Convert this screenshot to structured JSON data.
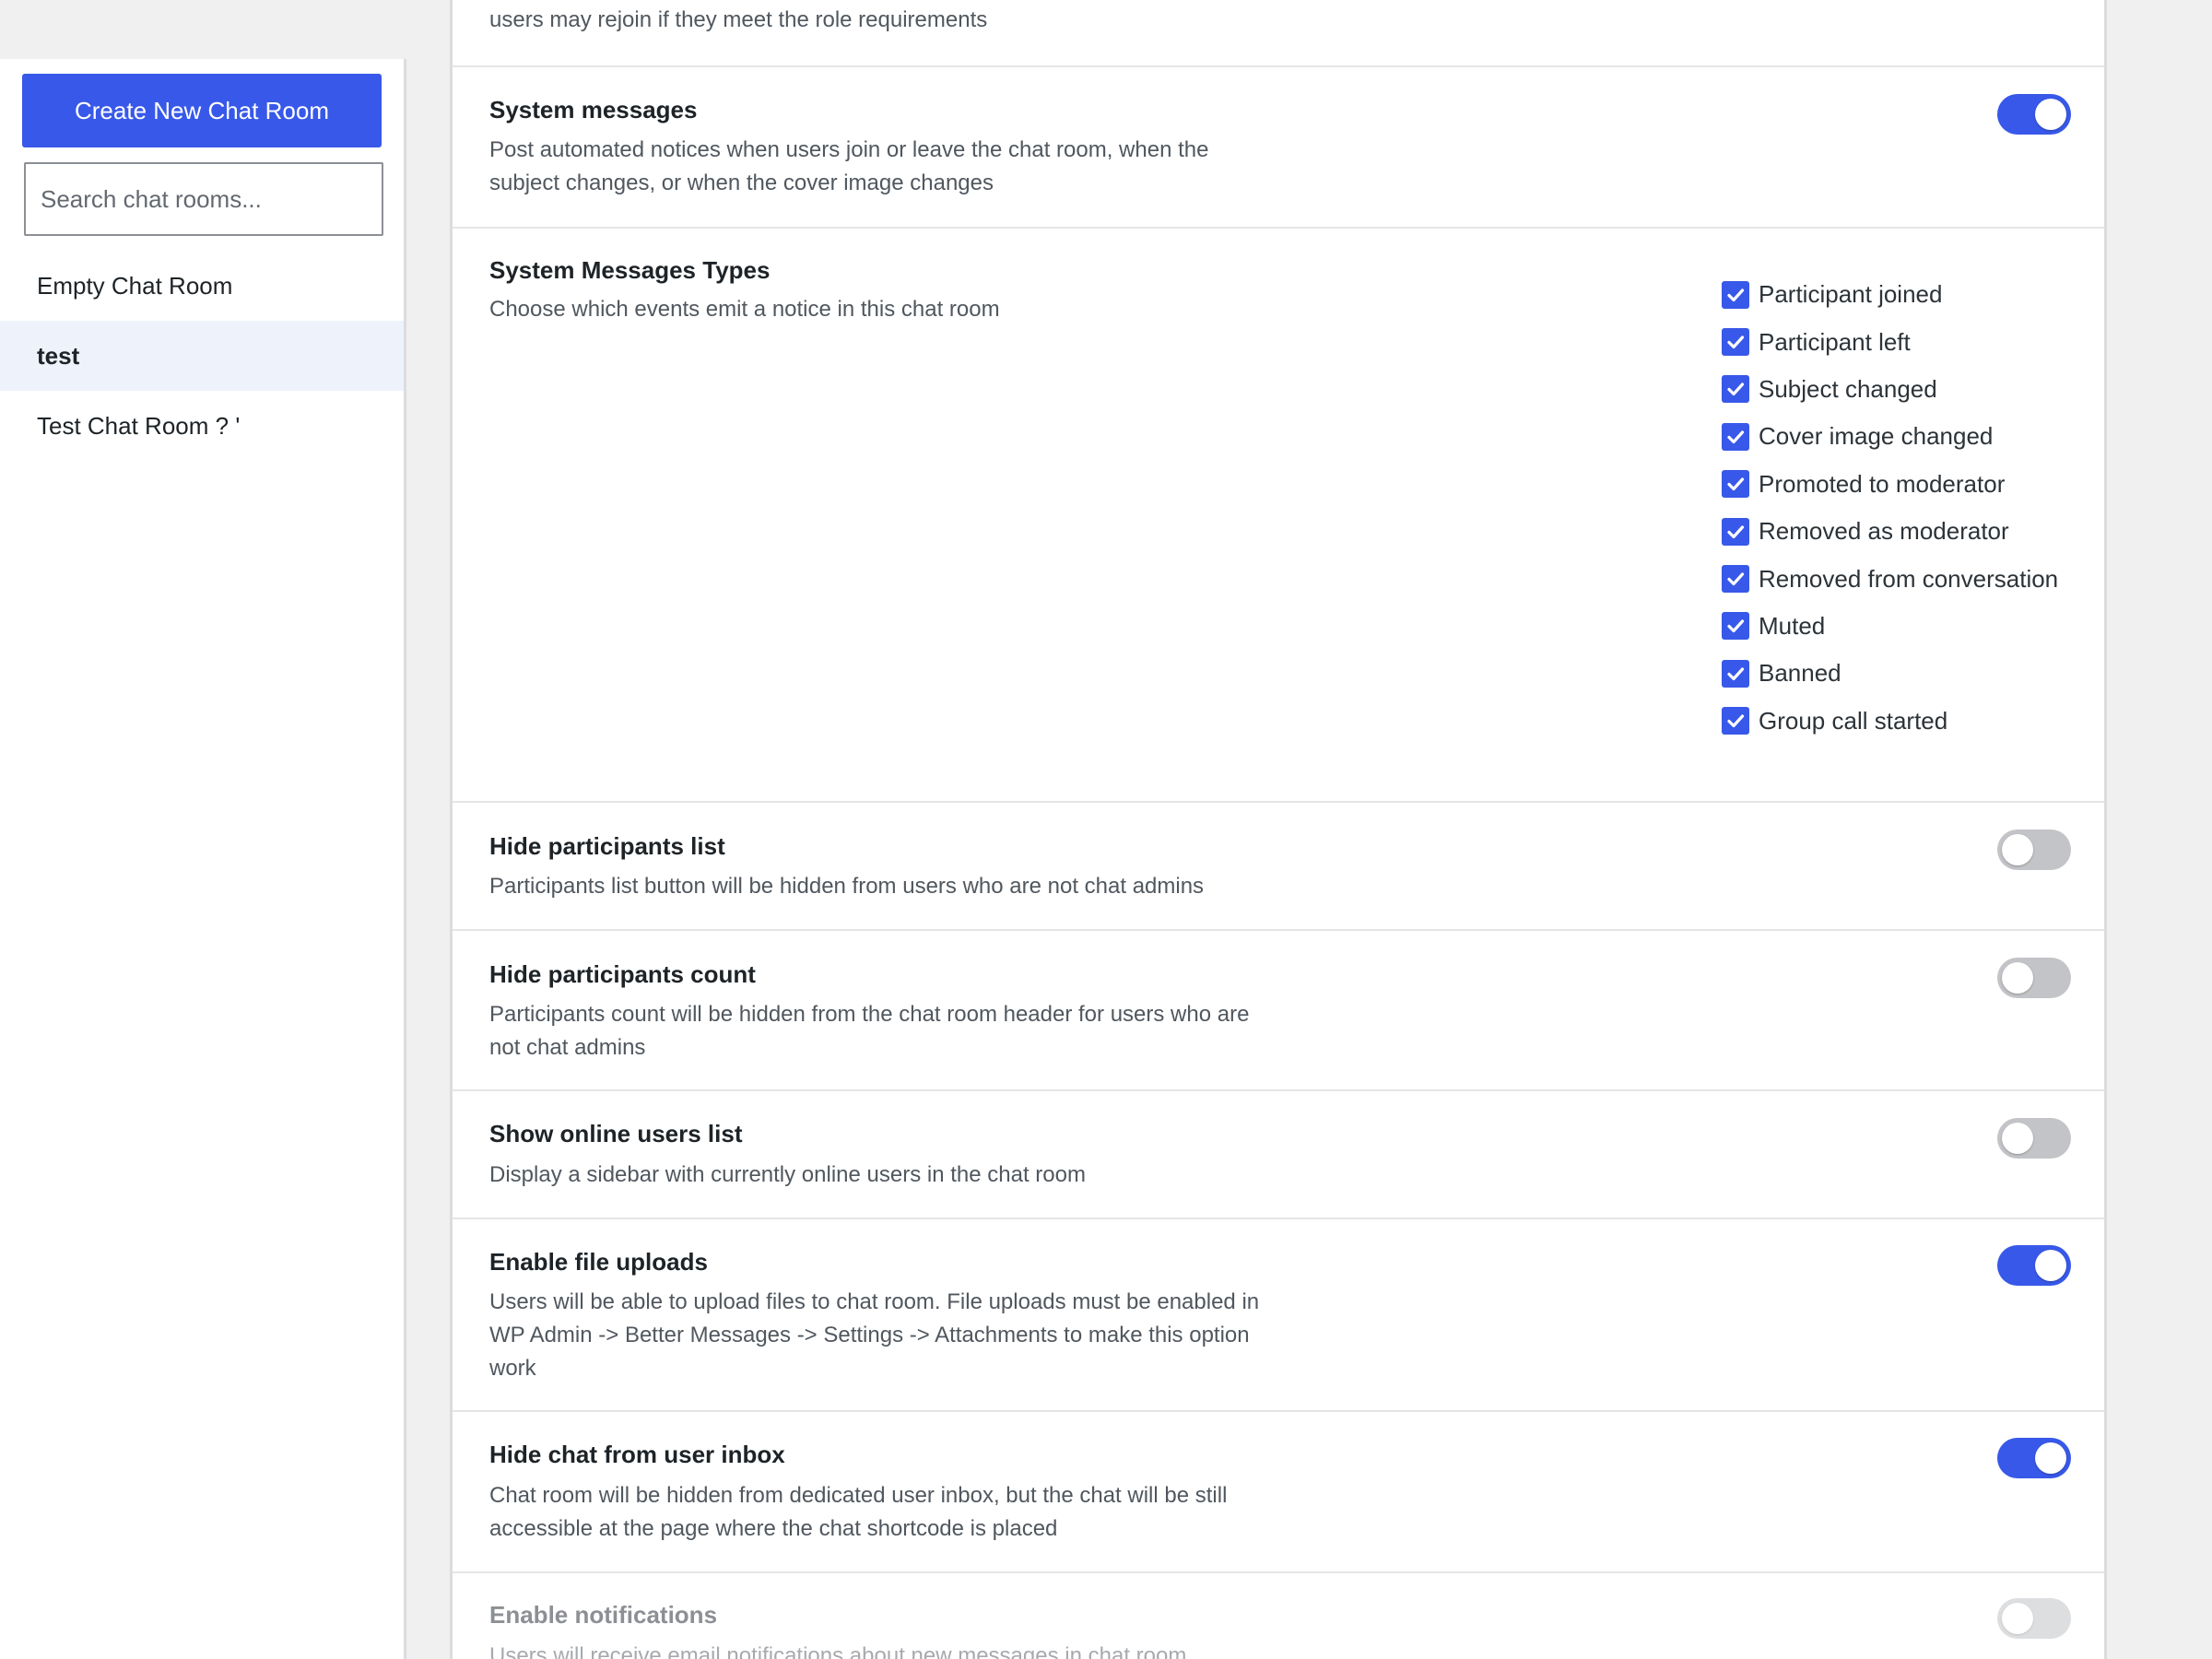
{
  "sidebar": {
    "create_button": "Create New Chat Room",
    "search_placeholder": "Search chat rooms...",
    "rooms": [
      {
        "label": "Empty Chat Room",
        "active": false
      },
      {
        "label": "test",
        "active": true
      },
      {
        "label": "Test Chat Room ? '",
        "active": false
      }
    ]
  },
  "settings": {
    "top_partial_desc": "users may rejoin if they meet the role requirements",
    "system_messages": {
      "title": "System messages",
      "desc": "Post automated notices when users join or leave the chat room, when the subject changes, or when the cover image changes",
      "enabled": true
    },
    "system_message_types": {
      "title": "System Messages Types",
      "desc": "Choose which events emit a notice in this chat room",
      "options": [
        {
          "label": "Participant joined",
          "checked": true
        },
        {
          "label": "Participant left",
          "checked": true
        },
        {
          "label": "Subject changed",
          "checked": true
        },
        {
          "label": "Cover image changed",
          "checked": true
        },
        {
          "label": "Promoted to moderator",
          "checked": true
        },
        {
          "label": "Removed as moderator",
          "checked": true
        },
        {
          "label": "Removed from conversation",
          "checked": true
        },
        {
          "label": "Muted",
          "checked": true
        },
        {
          "label": "Banned",
          "checked": true
        },
        {
          "label": "Group call started",
          "checked": true
        }
      ]
    },
    "hide_participants_list": {
      "title": "Hide participants list",
      "desc": "Participants list button will be hidden from users who are not chat admins",
      "enabled": false
    },
    "hide_participants_count": {
      "title": "Hide participants count",
      "desc": "Participants count will be hidden from the chat room header for users who are not chat admins",
      "enabled": false
    },
    "show_online_users": {
      "title": "Show online users list",
      "desc": "Display a sidebar with currently online users in the chat room",
      "enabled": false
    },
    "enable_file_uploads": {
      "title": "Enable file uploads",
      "desc": "Users will be able to upload files to chat room. File uploads must be enabled in WP Admin -> Better Messages -> Settings -> Attachments to make this option work",
      "enabled": true
    },
    "hide_from_inbox": {
      "title": "Hide chat from user inbox",
      "desc": "Chat room will be hidden from dedicated user inbox, but the chat will be still accessible at the page where the chat shortcode is placed",
      "enabled": true
    },
    "enable_notifications": {
      "title": "Enable notifications",
      "desc": "Users will receive email notifications about new messages in chat room",
      "enabled": false,
      "disabled": true
    }
  },
  "colors": {
    "accent": "#3858e9",
    "toggle_off": "#c3c4c7",
    "active_room_bg": "#eef3fb"
  }
}
